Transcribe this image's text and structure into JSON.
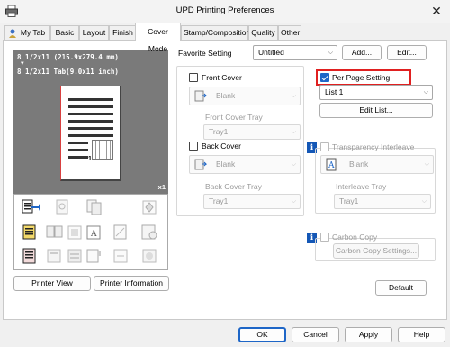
{
  "window": {
    "title": "UPD Printing Preferences",
    "close_glyph": "✕"
  },
  "tabs": [
    {
      "label": "My Tab"
    },
    {
      "label": "Basic"
    },
    {
      "label": "Layout"
    },
    {
      "label": "Finish"
    },
    {
      "label": "Cover Mode",
      "active": true
    },
    {
      "label": "Stamp/Composition"
    },
    {
      "label": "Quality"
    },
    {
      "label": "Other"
    }
  ],
  "preview": {
    "paper_line1": "8 1/2x11 (215.9x279.4 mm)",
    "arrow": "▼",
    "paper_line2": "8 1/2x11 Tab(9.0x11 inch)",
    "copies": "x1"
  },
  "favorite": {
    "label": "Favorite Setting",
    "value": "Untitled",
    "add_label": "Add...",
    "edit_label": "Edit..."
  },
  "front_cover": {
    "label": "Front Cover",
    "checked": false,
    "value": "Blank",
    "tray_label": "Front Cover Tray",
    "tray_value": "Tray1"
  },
  "back_cover": {
    "label": "Back Cover",
    "checked": false,
    "value": "Blank",
    "tray_label": "Back Cover Tray",
    "tray_value": "Tray1"
  },
  "per_page": {
    "label": "Per Page Setting",
    "checked": true,
    "value": "List 1",
    "edit_list_label": "Edit List..."
  },
  "transparency": {
    "label": "Transparency Interleave",
    "checked": false,
    "value": "Blank",
    "tray_label": "Interleave Tray",
    "tray_value": "Tray1"
  },
  "carbon": {
    "label": "Carbon Copy",
    "checked": false,
    "settings_label": "Carbon Copy Settings..."
  },
  "buttons": {
    "printer_view": "Printer View",
    "printer_information": "Printer Information",
    "default": "Default",
    "ok": "OK",
    "cancel": "Cancel",
    "apply": "Apply",
    "help": "Help"
  },
  "colors": {
    "accent": "#1e66c7",
    "highlight": "#e02020",
    "info": "#1457b6"
  }
}
